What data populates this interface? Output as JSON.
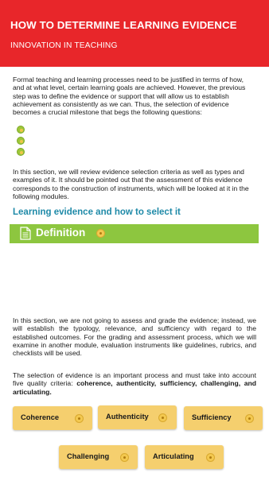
{
  "header": {
    "title": "HOW TO DETERMINE LEARNING EVIDENCE",
    "subtitle": "INNOVATION IN TEACHING",
    "background_color": "#e8262a"
  },
  "content": {
    "intro_paragraph": "Formal teaching and learning processes need to be justified in terms of how, and at what level, certain learning goals are achieved. However, the previous step was to define the evidence or support that will allow us to establish achievement as consistently as we can. Thus, the selection of evidence becomes a crucial milestone that begs the following questions:",
    "question_bullets": [
      {
        "icon": "green-dot-icon"
      },
      {
        "icon": "green-dot-icon"
      },
      {
        "icon": "green-dot-icon"
      }
    ],
    "review_paragraph": "In this section, we will review evidence selection criteria as well as types and examples of it. It should be pointed out that the assessment of this evidence corresponds to the construction of instruments, which will be looked at it in the following modules.",
    "section_heading": "Learning evidence and how to select it",
    "definition_bar": {
      "label": "Definition",
      "icon": "document-icon",
      "expand_icon": "yellow-dot-icon",
      "color": "#8dc63f"
    },
    "explain_paragraph": "In this section, we are not going to assess and grade the evidence; instead, we will establish the typology, relevance, and sufficiency with regard to the established outcomes. For the grading and assessment process, which we will examine in another module, evaluation instruments like guidelines, rubrics, and checklists will be used.",
    "criteria_paragraph_prefix": "The selection of evidence is an important process and must take into account five quality criteria: ",
    "criteria_paragraph_bold": "coherence, authenticity, sufficiency, challenging, and articulating.",
    "heading_color": "#1f8aa8"
  },
  "criteria_buttons": [
    {
      "label": "Coherence",
      "icon": "yellow-dot-icon"
    },
    {
      "label": "Authenticity",
      "icon": "yellow-dot-icon"
    },
    {
      "label": "Sufficiency",
      "icon": "yellow-dot-icon"
    },
    {
      "label": "Challenging",
      "icon": "yellow-dot-icon"
    },
    {
      "label": "Articulating",
      "icon": "yellow-dot-icon"
    }
  ],
  "chip_color": "#f5cf6e"
}
